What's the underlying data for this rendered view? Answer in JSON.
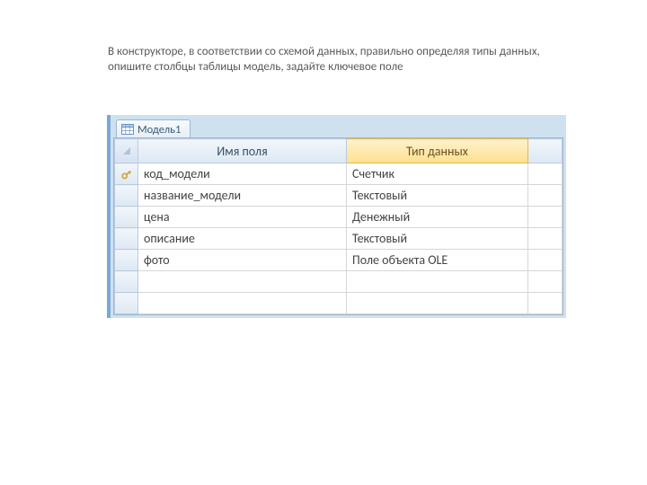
{
  "instruction": "В конструкторе, в соответствии со схемой данных, правильно определяя типы данных, опишите столбцы таблицы модель, задайте ключевое поле",
  "tab": {
    "label": "Модель1"
  },
  "columns": {
    "selector": "",
    "field_name": "Имя поля",
    "data_type": "Тип данных",
    "rest": ""
  },
  "rows": [
    {
      "key": true,
      "field": "код_модели",
      "type": "Счетчик"
    },
    {
      "key": false,
      "field": "название_модели",
      "type": "Текстовый"
    },
    {
      "key": false,
      "field": "цена",
      "type": "Денежный"
    },
    {
      "key": false,
      "field": "описание",
      "type": "Текстовый"
    },
    {
      "key": false,
      "field": "фото",
      "type": "Поле объекта OLE"
    }
  ],
  "empty_rows": 2
}
